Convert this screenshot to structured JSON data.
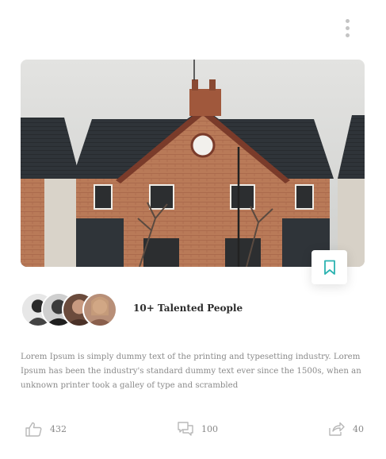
{
  "header": {
    "menu_icon": "more-vertical-icon"
  },
  "card": {
    "image_alt": "House",
    "bookmark_icon": "bookmark-icon",
    "people": {
      "label": "10+ Talented People",
      "avatar_count": 4
    },
    "description": "Lorem Ipsum is simply dummy text of the printing and typesetting industry. Lorem Ipsum has been the industry's standard dummy text ever since the 1500s, when an unknown printer took a galley of type and scrambled",
    "stats": {
      "likes": {
        "icon": "thumbs-up-icon",
        "count": "432"
      },
      "comments": {
        "icon": "comment-icon",
        "count": "100"
      },
      "shares": {
        "icon": "share-icon",
        "count": "40"
      }
    }
  },
  "colors": {
    "accent": "#2bb3b1",
    "muted_icon": "#b8b8b8",
    "text_muted": "#8a8a8a",
    "text_dark": "#2b2b2b"
  }
}
